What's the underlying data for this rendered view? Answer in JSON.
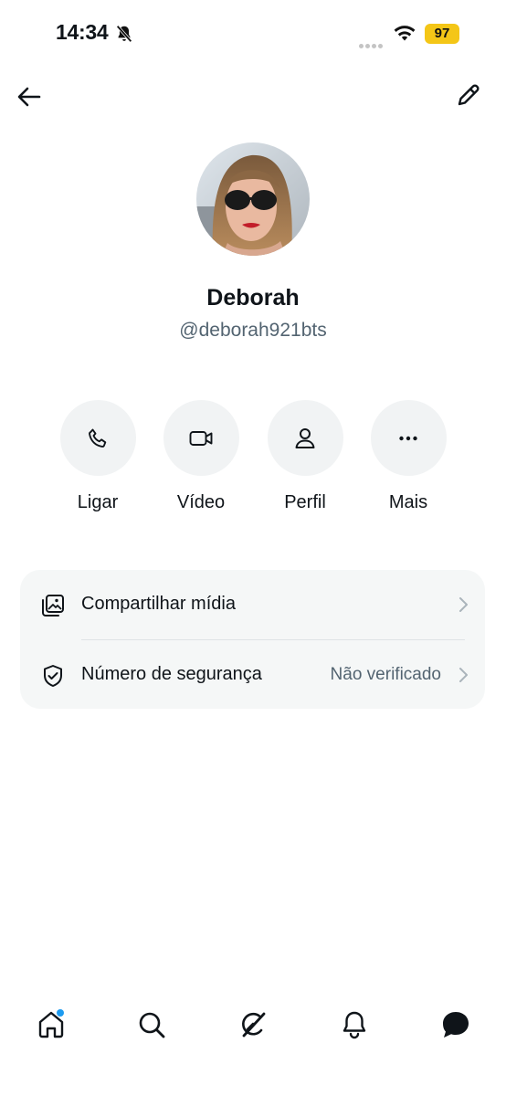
{
  "status_bar": {
    "time": "14:34",
    "battery": "97",
    "battery_color": "#f4c617"
  },
  "header": {
    "back_icon": "arrow-left-icon",
    "edit_icon": "pencil-icon"
  },
  "profile": {
    "name": "Deborah",
    "handle": "@deborah921bts",
    "avatar_alt": "avatar photo"
  },
  "actions": [
    {
      "label": "Ligar",
      "icon": "phone-icon"
    },
    {
      "label": "Vídeo",
      "icon": "video-camera-icon"
    },
    {
      "label": "Perfil",
      "icon": "person-icon"
    },
    {
      "label": "Mais",
      "icon": "more-dots-icon"
    }
  ],
  "settings": [
    {
      "label": "Compartilhar mídia",
      "value": "",
      "icon": "media-gallery-icon"
    },
    {
      "label": "Número de segurança",
      "value": "Não verificado",
      "icon": "shield-check-icon"
    }
  ],
  "nav": [
    {
      "name": "home",
      "icon": "home-icon",
      "active": true
    },
    {
      "name": "search",
      "icon": "search-icon"
    },
    {
      "name": "grok",
      "icon": "grok-icon"
    },
    {
      "name": "notifications",
      "icon": "bell-icon"
    },
    {
      "name": "messages",
      "icon": "chat-bubble-icon"
    }
  ],
  "colors": {
    "accent": "#1d9bf0",
    "text_primary": "#0f1419",
    "text_secondary": "#536471",
    "surface": "#f5f7f7"
  }
}
